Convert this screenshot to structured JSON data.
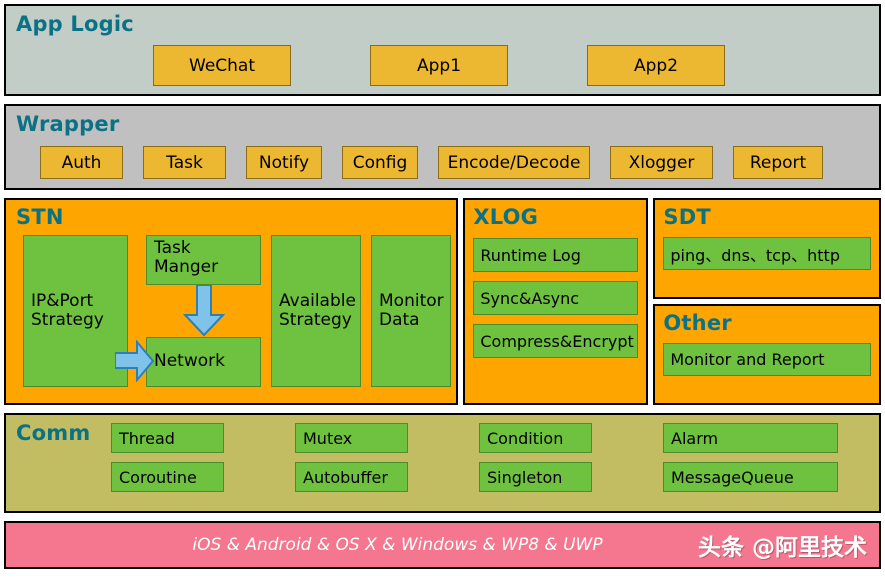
{
  "layers": {
    "app_logic": {
      "title": "App Logic",
      "bg": "#c3cdc7",
      "chips": [
        {
          "label": "WeChat"
        },
        {
          "label": "App1"
        },
        {
          "label": "App2"
        }
      ]
    },
    "wrapper": {
      "title": "Wrapper",
      "bg": "#c0c0c0",
      "chips": [
        {
          "label": "Auth"
        },
        {
          "label": "Task"
        },
        {
          "label": "Notify"
        },
        {
          "label": "Config"
        },
        {
          "label": "Encode/Decode"
        },
        {
          "label": "Xlogger"
        },
        {
          "label": "Report"
        }
      ]
    },
    "stn": {
      "title": "STN",
      "bg": "#ffa500",
      "boxes": [
        {
          "label": "IP&Port Strategy"
        },
        {
          "label": "Task Manger"
        },
        {
          "label": "Network"
        },
        {
          "label": "Available Strategy"
        },
        {
          "label": "Monitor Data"
        }
      ],
      "arrows": [
        {
          "name": "task-manger-to-network",
          "direction": "down"
        },
        {
          "name": "ipport-to-network",
          "direction": "right"
        }
      ]
    },
    "xlog": {
      "title": "XLOG",
      "bg": "#ffa500",
      "items": [
        {
          "label": "Runtime Log"
        },
        {
          "label": "Sync&Async"
        },
        {
          "label": "Compress&Encrypt"
        }
      ]
    },
    "sdt": {
      "title": "SDT",
      "bg": "#ffa500",
      "items": [
        {
          "label": "ping、dns、tcp、http"
        }
      ]
    },
    "other": {
      "title": "Other",
      "bg": "#ffa500",
      "items": [
        {
          "label": "Monitor and Report"
        }
      ]
    },
    "comm": {
      "title": "Comm",
      "bg": "#c2bc62",
      "rows": [
        [
          {
            "label": "Thread"
          },
          {
            "label": "Mutex"
          },
          {
            "label": "Condition"
          },
          {
            "label": "Alarm"
          }
        ],
        [
          {
            "label": "Coroutine"
          },
          {
            "label": "Autobuffer"
          },
          {
            "label": "Singleton"
          },
          {
            "label": "MessageQueue"
          }
        ]
      ]
    },
    "platform": {
      "label": "iOS & Android & OS X & Windows & WP8 & UWP",
      "bg": "#f4778f",
      "watermark": "头条 @阿里技术"
    }
  },
  "colors": {
    "title_teal": "#0b7285",
    "chip_yellow": "#ecb731",
    "chip_green": "#6ec23f",
    "orange": "#ffa500",
    "arrow_blue": "#7fc3ea",
    "arrow_blue_border": "#2d7fb8"
  }
}
